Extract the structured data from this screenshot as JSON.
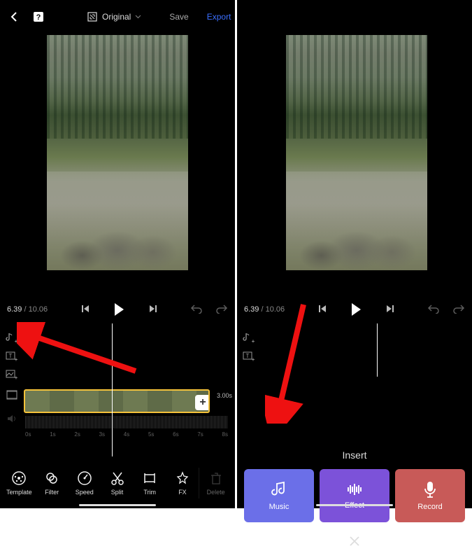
{
  "left": {
    "topbar": {
      "aspect_label": "Original",
      "save_label": "Save",
      "export_label": "Export"
    },
    "playback": {
      "current": "6.39",
      "total": "10.06"
    },
    "clip_duration": "3.00s",
    "ruler": [
      "0s",
      "1s",
      "2s",
      "3s",
      "4s",
      "5s",
      "6s",
      "7s",
      "8s"
    ],
    "tools": {
      "template": "Template",
      "filter": "Filter",
      "speed": "Speed",
      "split": "Split",
      "trim": "Trim",
      "fx": "FX",
      "delete": "Delete"
    }
  },
  "right": {
    "playback": {
      "current": "6.39",
      "total": "10.06"
    },
    "insert_title": "Insert",
    "cards": {
      "music": "Music",
      "effect": "Effect",
      "record": "Record"
    }
  }
}
